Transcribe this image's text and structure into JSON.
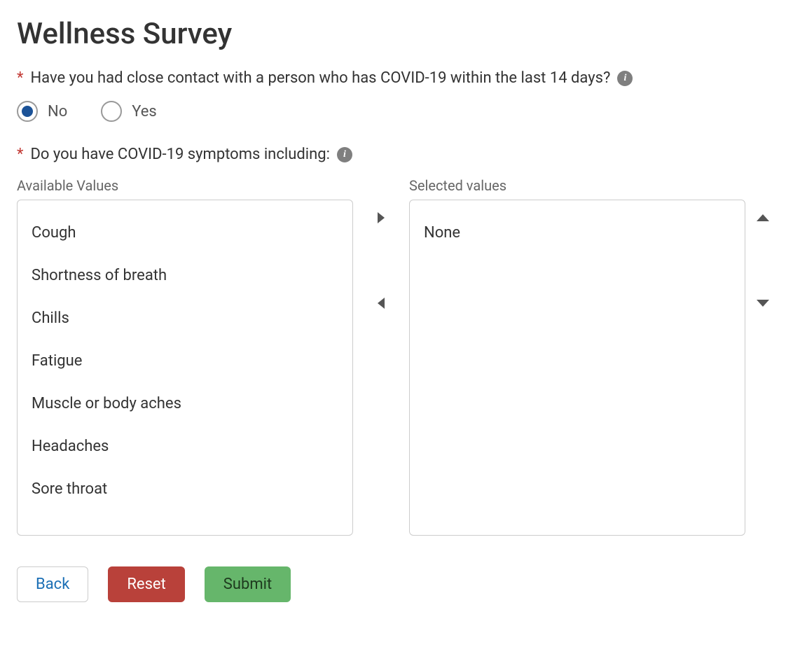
{
  "title": "Wellness Survey",
  "questions": {
    "contact": {
      "text": "Have you had close contact with a person who has COVID-19 within the last 14 days?",
      "options": {
        "no": "No",
        "yes": "Yes"
      },
      "selected": "no"
    },
    "symptoms": {
      "text": "Do you have COVID-19 symptoms including:",
      "available_label": "Available Values",
      "selected_label": "Selected values",
      "available": [
        "Cough",
        "Shortness of breath",
        "Chills",
        "Fatigue",
        "Muscle or body aches",
        "Headaches",
        "Sore throat"
      ],
      "selected": [
        "None"
      ]
    }
  },
  "buttons": {
    "back": "Back",
    "reset": "Reset",
    "submit": "Submit"
  }
}
